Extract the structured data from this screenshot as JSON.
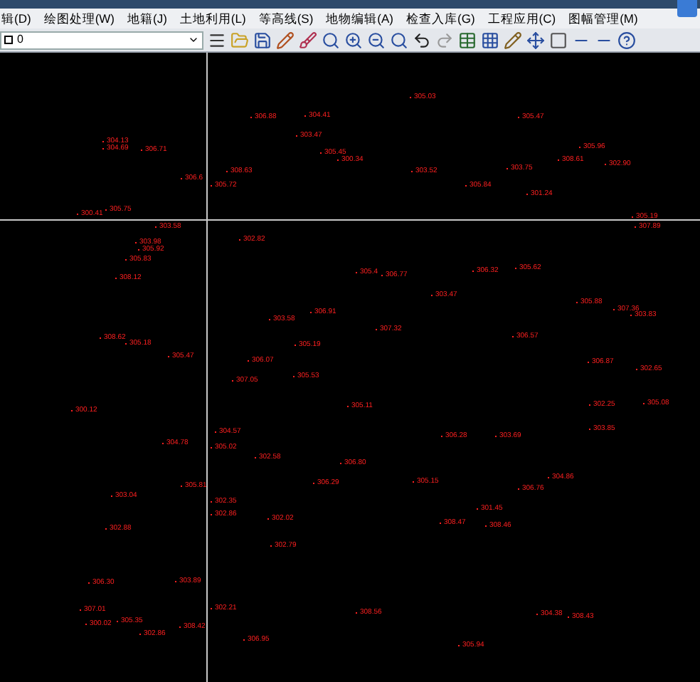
{
  "menu_bar": {
    "items": [
      {
        "label": "辑(D)"
      },
      {
        "label": "绘图处理(W)"
      },
      {
        "label": "地籍(J)"
      },
      {
        "label": "土地利用(L)"
      },
      {
        "label": "等高线(S)"
      },
      {
        "label": "地物编辑(A)"
      },
      {
        "label": "检查入库(G)"
      },
      {
        "label": "工程应用(C)"
      },
      {
        "label": "图幅管理(M)"
      }
    ]
  },
  "toolbar": {
    "layer": "0"
  },
  "drawing": {
    "points": [
      {
        "label": "306.88"
      },
      {
        "label": "304.41"
      },
      {
        "label": "303.47"
      },
      {
        "label": "305.03"
      },
      {
        "label": "305.47"
      },
      {
        "label": "304.13"
      },
      {
        "label": "304.69"
      },
      {
        "label": "306.71"
      },
      {
        "label": "305.45"
      },
      {
        "label": "300.34"
      },
      {
        "label": "308.63"
      },
      {
        "label": "303.52"
      },
      {
        "label": "305.96"
      },
      {
        "label": "308.61"
      },
      {
        "label": "302.90"
      },
      {
        "label": "303.75"
      },
      {
        "label": "305.84"
      },
      {
        "label": "301.24"
      },
      {
        "label": "306.6"
      },
      {
        "label": "305.72"
      },
      {
        "label": "305.75"
      },
      {
        "label": "300.41"
      },
      {
        "label": "303.58"
      },
      {
        "label": "302.82"
      },
      {
        "label": "303.98"
      },
      {
        "label": "305.92"
      },
      {
        "label": "305.83"
      },
      {
        "label": "308.12"
      },
      {
        "label": "305.19"
      },
      {
        "label": "307.89"
      },
      {
        "label": "305.4"
      },
      {
        "label": "306.77"
      },
      {
        "label": "306.32"
      },
      {
        "label": "305.62"
      },
      {
        "label": "303.47"
      },
      {
        "label": "305.88"
      },
      {
        "label": "307.36"
      },
      {
        "label": "303.83"
      },
      {
        "label": "303.58"
      },
      {
        "label": "306.91"
      },
      {
        "label": "307.32"
      },
      {
        "label": "306.57"
      },
      {
        "label": "308.62"
      },
      {
        "label": "305.18"
      },
      {
        "label": "305.47"
      },
      {
        "label": "305.19"
      },
      {
        "label": "306.07"
      },
      {
        "label": "307.05"
      },
      {
        "label": "305.53"
      },
      {
        "label": "306.87"
      },
      {
        "label": "302.65"
      },
      {
        "label": "300.12"
      },
      {
        "label": "305.11"
      },
      {
        "label": "302.25"
      },
      {
        "label": "305.08"
      },
      {
        "label": "303.85"
      },
      {
        "label": "304.57"
      },
      {
        "label": "304.78"
      },
      {
        "label": "305.02"
      },
      {
        "label": "302.58"
      },
      {
        "label": "306.80"
      },
      {
        "label": "306.28"
      },
      {
        "label": "303.69"
      },
      {
        "label": "304.86"
      },
      {
        "label": "306.76"
      },
      {
        "label": "305.15"
      },
      {
        "label": "306.29"
      },
      {
        "label": "303.04"
      },
      {
        "label": "305.81"
      },
      {
        "label": "302.35"
      },
      {
        "label": "302.86"
      },
      {
        "label": "302.02"
      },
      {
        "label": "302.88"
      },
      {
        "label": "301.45"
      },
      {
        "label": "308.47"
      },
      {
        "label": "308.46"
      },
      {
        "label": "302.79"
      },
      {
        "label": "306.30"
      },
      {
        "label": "303.89"
      },
      {
        "label": "307.01"
      },
      {
        "label": "300.02"
      },
      {
        "label": "305.35"
      },
      {
        "label": "302.86"
      },
      {
        "label": "302.21"
      },
      {
        "label": "308.42"
      },
      {
        "label": "306.95"
      },
      {
        "label": "308.56"
      },
      {
        "label": "305.94"
      },
      {
        "label": "304.38"
      },
      {
        "label": "308.43"
      }
    ]
  }
}
